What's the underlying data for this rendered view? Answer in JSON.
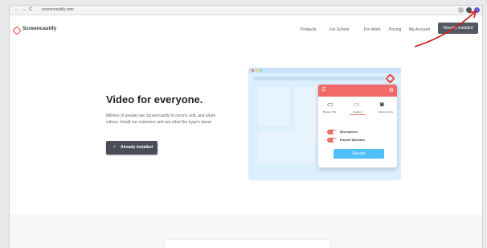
{
  "browser": {
    "nav_back": "←",
    "nav_forward": "→",
    "nav_reload": "C",
    "url": "screencastify.com"
  },
  "site": {
    "logo_text": "Screencastify",
    "nav": [
      "Products",
      "For School",
      "For Work",
      "Pricing",
      "My Account"
    ],
    "cta_label": "Already installed"
  },
  "hero": {
    "title": "Video for everyone.",
    "description": "Millions of people use Screencastify to record, edit, and share videos. Install our extension and see what the hype's about",
    "button_label": "Already installed",
    "button_icon": "check-icon"
  },
  "illustration": {
    "popup": {
      "tabs": [
        {
          "label": "Browser Tab",
          "icon": "tab-icon"
        },
        {
          "label": "Desktop",
          "icon": "desktop-icon"
        },
        {
          "label": "Webcam Only",
          "icon": "camera-icon"
        }
      ],
      "toggles": [
        {
          "label": "Microphone",
          "on": true
        },
        {
          "label": "Embed Webcam",
          "on": true
        }
      ],
      "record_label": "Record"
    }
  },
  "colors": {
    "accent": "#e9463a",
    "popup_header": "#f06a6a",
    "record": "#4fc0f5",
    "illustration_bg": "#dceffd",
    "annotation_arrow": "#cc1f1f"
  }
}
